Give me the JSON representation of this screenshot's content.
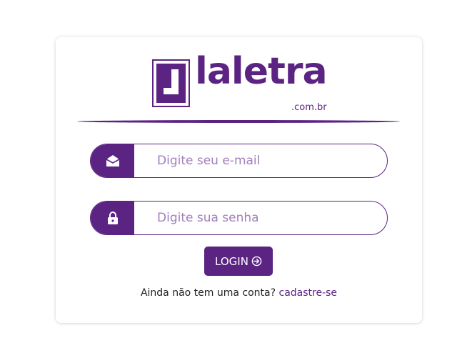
{
  "brand": {
    "name": "laletra",
    "domain": ".com.br",
    "color": "#5b2483"
  },
  "form": {
    "email": {
      "icon": "envelope-open-icon",
      "placeholder": "Digite seu e-mail",
      "value": ""
    },
    "password": {
      "icon": "lock-icon",
      "placeholder": "Digite sua senha",
      "value": ""
    },
    "login_button": {
      "label": "LOGIN",
      "icon": "sign-in-icon"
    }
  },
  "signup": {
    "prompt": "Ainda não tem uma conta?",
    "link": "cadastre-se"
  }
}
